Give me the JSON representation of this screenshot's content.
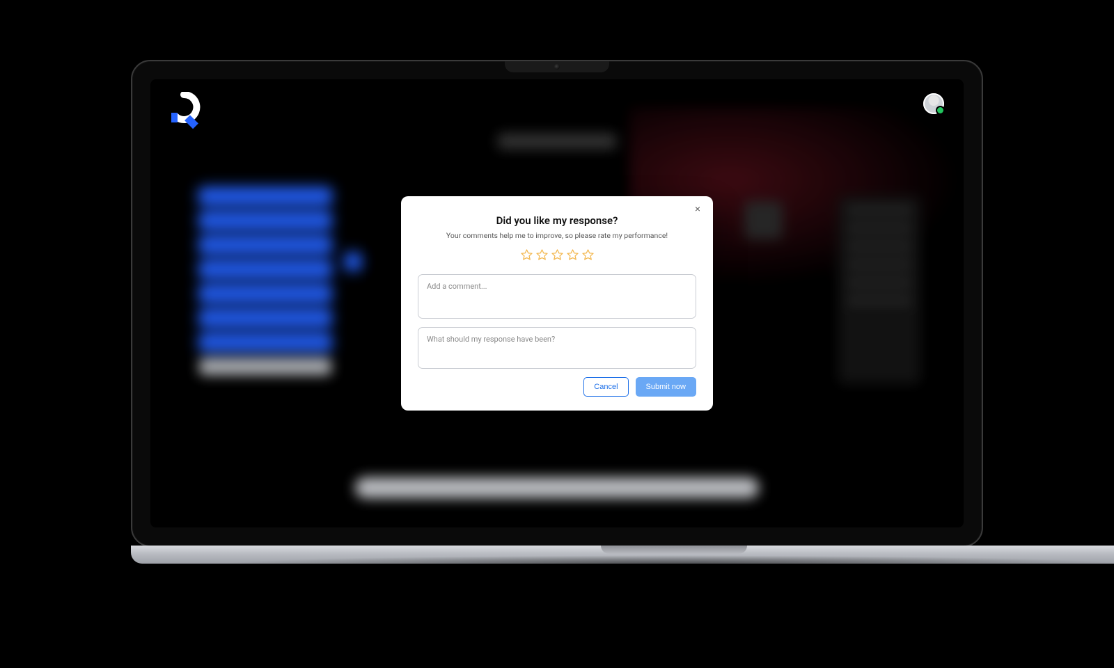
{
  "modal": {
    "title": "Did you like my response?",
    "subtitle": "Your comments help me to improve, so please rate my performance!",
    "close_glyph": "×",
    "star_count": 5,
    "star_rating": 0,
    "comment_placeholder": "Add a comment...",
    "response_placeholder": "What should my response have been?",
    "cancel_label": "Cancel",
    "submit_label": "Submit now"
  },
  "colors": {
    "accent_blue": "#2563ff",
    "star_outline": "#f3b74e",
    "submit_bg": "#6aa8f5"
  }
}
